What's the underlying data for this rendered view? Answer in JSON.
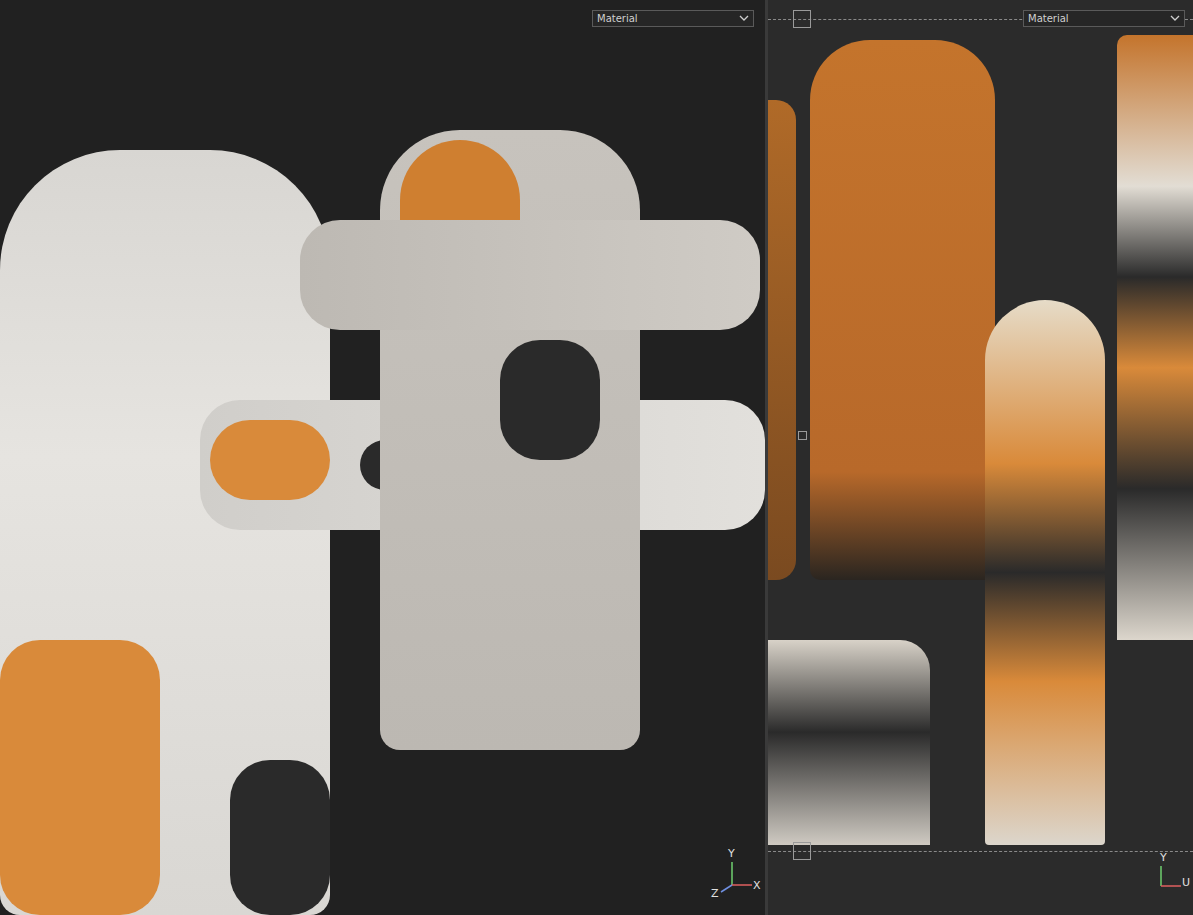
{
  "viewports": [
    {
      "shading": "Material",
      "gizmo": {
        "y": "Y",
        "z": "Z",
        "x": "X"
      }
    },
    {
      "shading": "Material",
      "gizmo": {
        "y": "Y",
        "u": "U"
      }
    }
  ]
}
